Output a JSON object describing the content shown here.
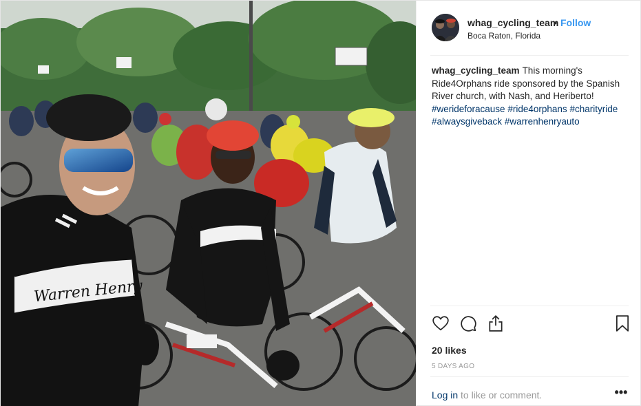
{
  "post": {
    "username": "whag_cycling_team",
    "separator": "•",
    "follow_label": "Follow",
    "location": "Boca Raton, Florida",
    "caption": {
      "username": "whag_cycling_team",
      "text": "This morning's Ride4Orphans ride sponsored by the Spanish River church, with Nash, and Heriberto!",
      "hashtags": [
        "#werideforacause",
        "#ride4orphans",
        "#charityride",
        "#alwaysgiveback",
        "#warrenhenryauto"
      ]
    },
    "likes": "20 likes",
    "timestamp": "5 DAYS AGO",
    "login": {
      "link": "Log in",
      "rest": "to like or comment."
    },
    "more_label": "•••"
  },
  "photo": {
    "jersey_text": "Warren Henry",
    "icons": [
      "heart-icon",
      "comment-icon",
      "share-icon",
      "bookmark-icon"
    ]
  },
  "colors": {
    "link_blue": "#3897f0",
    "hashtag_blue": "#003569",
    "muted_gray": "#999999",
    "divider": "#efefef",
    "text": "#262626"
  }
}
